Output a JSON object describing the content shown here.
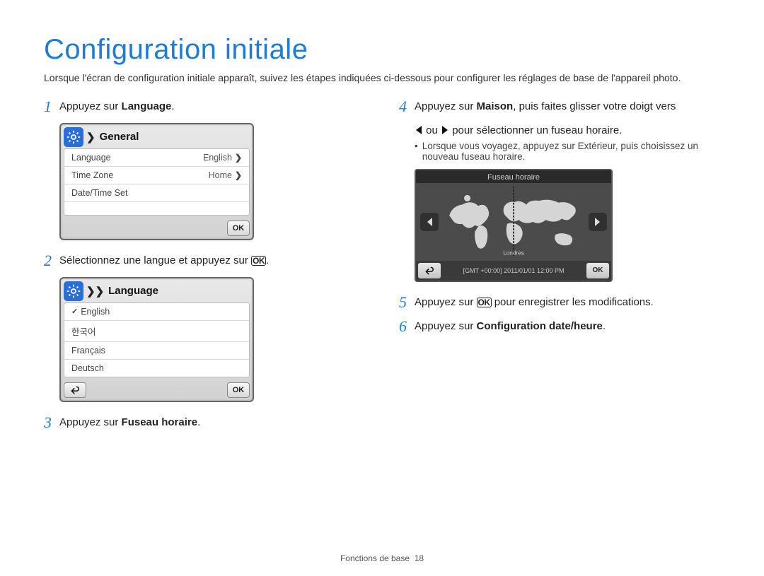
{
  "title": "Configuration initiale",
  "intro": "Lorsque l'écran de configuration initiale apparaît, suivez les étapes indiquées ci-dessous pour configurer les réglages de base de l'appareil photo.",
  "steps": {
    "s1_num": "1",
    "s1_pre": "Appuyez sur ",
    "s1_bold": "Language",
    "s1_post": ".",
    "s2_num": "2",
    "s2_pre": "Sélectionnez une langue et appuyez sur ",
    "s2_post": ".",
    "s3_num": "3",
    "s3_pre": "Appuyez sur ",
    "s3_bold": "Fuseau horaire",
    "s3_post": ".",
    "s4_num": "4",
    "s4_line1_pre": "Appuyez sur ",
    "s4_line1_bold": "Maison",
    "s4_line1_post": ", puis faites glisser votre doigt vers",
    "s4_line2_mid": " ou ",
    "s4_line2_post": " pour sélectionner un fuseau horaire.",
    "s4_bullet_pre": "Lorsque vous voyagez, appuyez sur ",
    "s4_bullet_bold": "Extérieur",
    "s4_bullet_post": ", puis choisissez un nouveau fuseau horaire.",
    "s5_num": "5",
    "s5_pre": "Appuyez sur ",
    "s5_post": " pour enregistrer les modifications.",
    "s6_num": "6",
    "s6_pre": "Appuyez sur ",
    "s6_bold": "Configuration date/heure",
    "s6_post": "."
  },
  "ok_label": "OK",
  "device1": {
    "title": "General",
    "rows": [
      {
        "label": "Language",
        "value": "English"
      },
      {
        "label": "Time Zone",
        "value": "Home"
      },
      {
        "label": "Date/Time Set",
        "value": ""
      }
    ],
    "ok": "OK"
  },
  "device2": {
    "title": "Language",
    "options": [
      "English",
      "한국어",
      "Français",
      "Deutsch"
    ],
    "ok": "OK"
  },
  "world": {
    "title": "Fuseau horaire",
    "city": "Londres",
    "status": "[GMT +00:00] 2011/01/01 12:00 PM",
    "ok": "OK"
  },
  "footer_label": "Fonctions de base",
  "footer_page": "18"
}
